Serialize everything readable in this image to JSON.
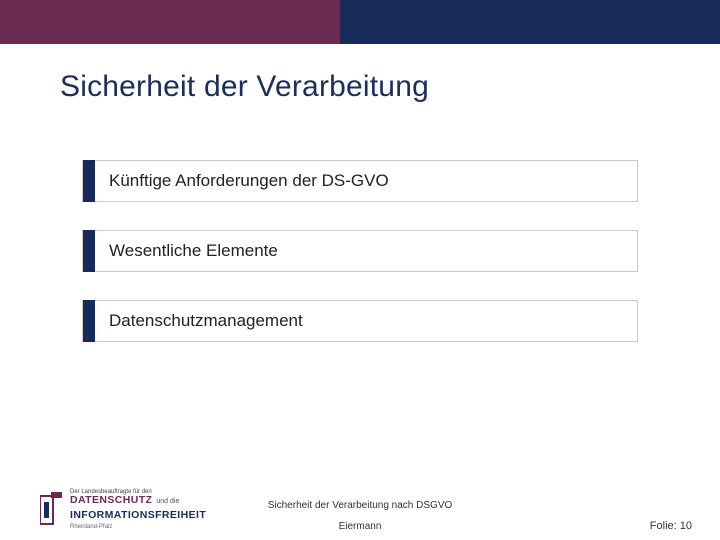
{
  "title": "Sicherheit der Verarbeitung",
  "items": [
    "Künftige Anforderungen der DS-GVO",
    "Wesentliche Elemente",
    "Datenschutzmanagement"
  ],
  "logo": {
    "line1": "Der Landesbeauftragte für den",
    "word_ds": "DATENSCHUTZ",
    "and": "und die",
    "word_if": "INFORMATIONSFREIHEIT",
    "region": "Rheinland-Pfalz"
  },
  "footer": {
    "line1": "Sicherheit der Verarbeitung nach DSGVO",
    "line2": "Eiermann",
    "page_label": "Folie: 10"
  },
  "colors": {
    "purple": "#6b2a52",
    "navy": "#172b5b"
  }
}
